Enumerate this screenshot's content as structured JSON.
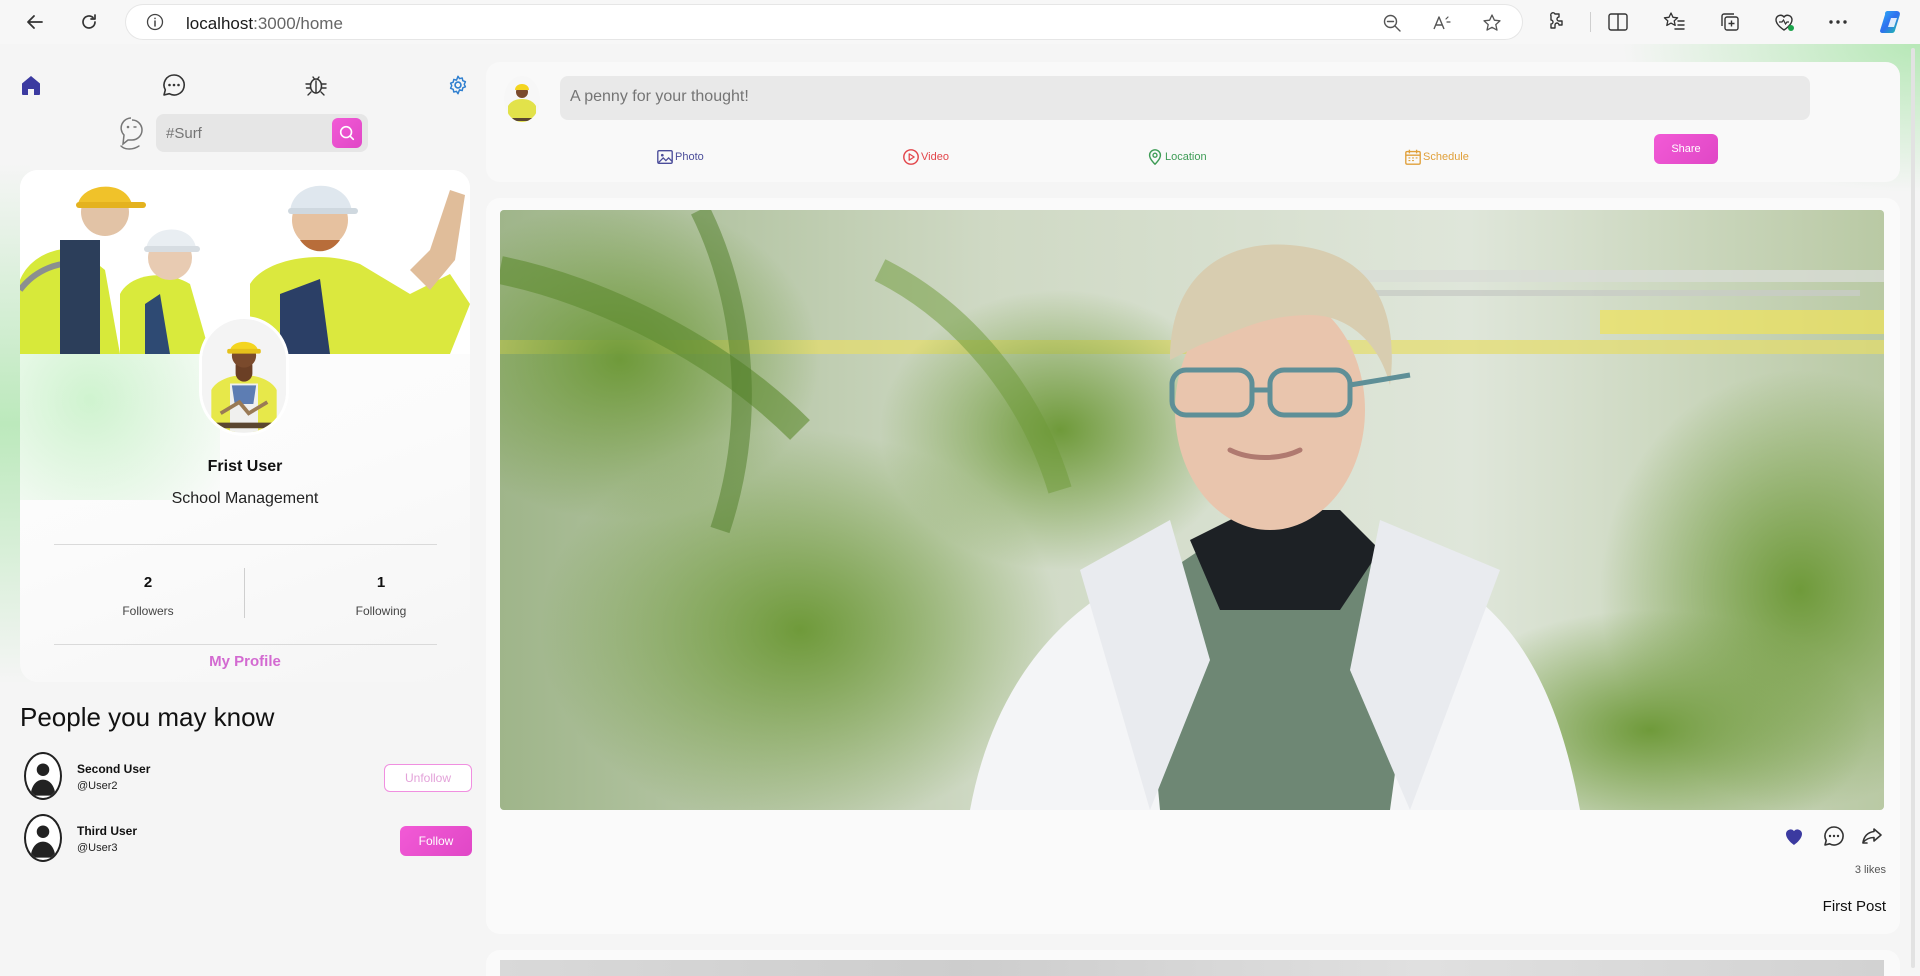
{
  "browser": {
    "url_host": "localhost",
    "url_path": ":3000/home"
  },
  "nav": {
    "search_placeholder": "#Surf"
  },
  "profile": {
    "name": "Frist User",
    "role": "School Management",
    "followers_count": "2",
    "followers_label": "Followers",
    "following_count": "1",
    "following_label": "Following",
    "my_profile_label": "My Profile"
  },
  "people": {
    "title": "People you may know",
    "list": [
      {
        "name": "Second User",
        "handle": "@User2",
        "action": "Unfollow"
      },
      {
        "name": "Third User",
        "handle": "@User3",
        "action": "Follow"
      }
    ]
  },
  "composer": {
    "placeholder": "A penny for your thought!",
    "actions": [
      {
        "label": "Photo",
        "color": "#4b4d9a"
      },
      {
        "label": "Video",
        "color": "#e2464b"
      },
      {
        "label": "Location",
        "color": "#3e9c56"
      },
      {
        "label": "Schedule",
        "color": "#e0a03a"
      }
    ],
    "share_label": "Share"
  },
  "post": {
    "likes_text": "3 likes",
    "caption": "First Post"
  },
  "colors": {
    "accent": "#e94bd0",
    "heart": "#3b3aa0",
    "home_icon": "#3b3aa0",
    "settings_icon": "#2f7fcf"
  }
}
